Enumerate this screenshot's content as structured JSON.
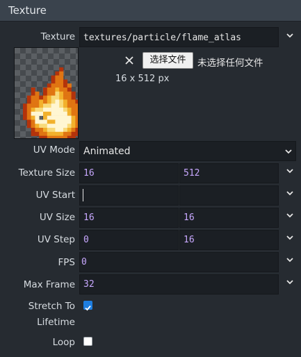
{
  "section": {
    "title": "Texture"
  },
  "texture": {
    "label": "Texture",
    "path": "textures/particle/flame_atlas",
    "file_button_label": "选择文件",
    "file_status": "未选择任何文件",
    "dimensions": "16 x 512 px"
  },
  "uv_mode": {
    "label": "UV Mode",
    "value": "Animated"
  },
  "texture_size": {
    "label": "Texture Size",
    "x": "16",
    "y": "512"
  },
  "uv_start": {
    "label": "UV Start",
    "x": "",
    "y": ""
  },
  "uv_size": {
    "label": "UV Size",
    "x": "16",
    "y": "16"
  },
  "uv_step": {
    "label": "UV Step",
    "x": "0",
    "y": "16"
  },
  "fps": {
    "label": "FPS",
    "value": "0"
  },
  "max_frame": {
    "label": "Max Frame",
    "value": "32"
  },
  "stretch_to_lifetime": {
    "label_line1": "Stretch To",
    "label_line2": "Lifetime",
    "checked": true
  },
  "loop": {
    "label": "Loop",
    "checked": false
  },
  "colors": {
    "background": "#262b31",
    "field": "#1b1f24",
    "number_value": "#c8a8ff",
    "checkbox_on": "#1e7ee0"
  },
  "icons": {
    "dropdown": "chevron-down-icon",
    "clear": "close-icon",
    "checked": "checkmark-icon"
  }
}
